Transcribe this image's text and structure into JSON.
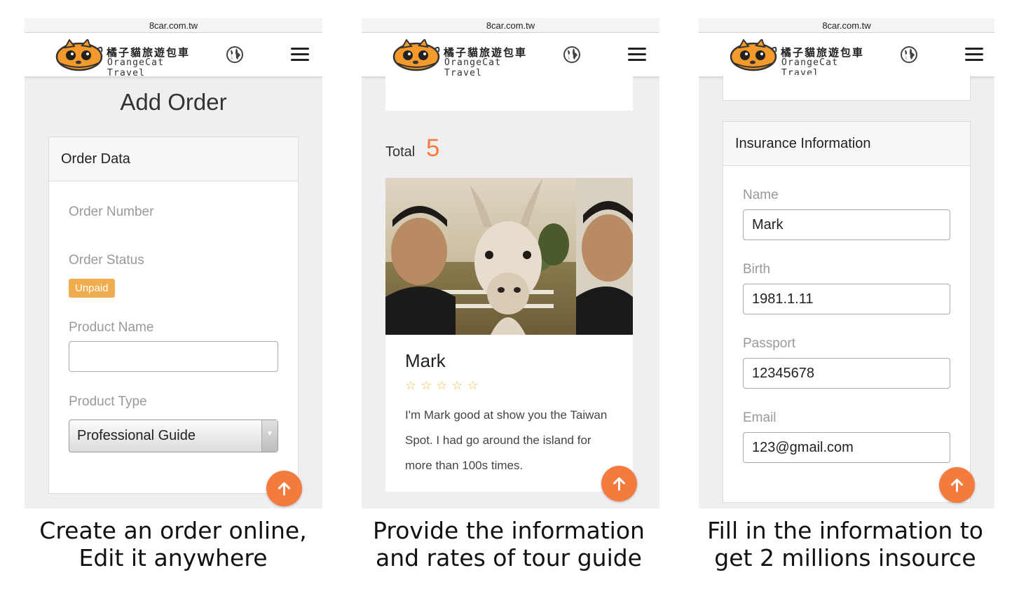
{
  "browser": {
    "url": "8car.com.tw"
  },
  "brand": {
    "name_zh": "橘子貓旅遊包車",
    "name_en": "OrangeCat Travel"
  },
  "screens": {
    "add_order": {
      "title": "Add Order",
      "card_title": "Order Data",
      "order_number_label": "Order Number",
      "order_status_label": "Order Status",
      "order_status_badge": "Unpaid",
      "product_name_label": "Product Name",
      "product_name_value": "",
      "product_type_label": "Product Type",
      "product_type_value": "Professional Guide"
    },
    "guide_list": {
      "total_label": "Total",
      "total_count": "5",
      "guide": {
        "name": "Mark",
        "rating_stars": "☆☆☆☆☆",
        "bio": "I'm Mark good at show you the Taiwan Spot. I had go around the island for more than 100s times."
      }
    },
    "insurance": {
      "card_title": "Insurance Information",
      "name_label": "Name",
      "name_value": "Mark",
      "birth_label": "Birth",
      "birth_value": "1981.1.11",
      "passport_label": "Passport",
      "passport_value": "12345678",
      "email_label": "Email",
      "email_value": "123@gmail.com"
    }
  },
  "captions": {
    "first_line1": "Create an order online,",
    "first_line2": "Edit it anywhere",
    "second_line1": "Provide the information",
    "second_line2": "and rates of tour guide",
    "third_line1": "Fill in the information to",
    "third_line2": "get 2 millions insource"
  },
  "colors": {
    "accent": "#f47b3e",
    "badge": "#f0ad4e",
    "star": "#f0c14b",
    "page_bg": "#efefef"
  },
  "icons": {
    "globe": "globe-icon",
    "menu": "hamburger-menu-icon",
    "scroll_top": "arrow-up-icon"
  }
}
